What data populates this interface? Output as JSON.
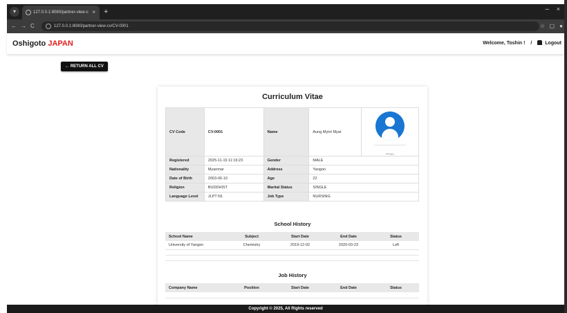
{
  "browser": {
    "tab_title": "127.0.0.1:8080/partner-view-c",
    "tab_close": "×",
    "new_tab": "+",
    "back": "←",
    "forward": "→",
    "reload": "C",
    "url": "127.0.0.1:8080/partner-view-cv/CV-0001",
    "window_minimize": "–",
    "window_close": "×",
    "icons": [
      "globe-icon",
      "star-icon",
      "extensions-icon",
      "profile-icon"
    ]
  },
  "nav": {
    "brand": "Oshigoto",
    "brand_accent": "JAPAN",
    "welcome": "Welcome, Toshin !",
    "separator": "/",
    "logout": "Logout"
  },
  "return_button": "← RETURN ALL CV",
  "cv": {
    "title": "Curriculum Vitae",
    "cv_code_label": "CV Code",
    "cv_code": "CV-0001",
    "name_label": "Name",
    "name": "Aung Myint Myat",
    "photo_caption": "Photo",
    "rows": [
      {
        "l1": "Registered",
        "v1": "2025-11-19 11:16:23",
        "l2": "Gender",
        "v2": "MALE"
      },
      {
        "l1": "Nationality",
        "v1": "Myanmar",
        "l2": "Address",
        "v2": "Yangon"
      },
      {
        "l1": "Date of Birth",
        "v1": "2003-06-10",
        "l2": "Age",
        "v2": "22"
      },
      {
        "l1": "Religion",
        "v1": "BUDDHIST",
        "l2": "Marital Status",
        "v2": "SINGLE"
      },
      {
        "l1": "Language Level",
        "v1": "JLPT N1",
        "l2": "Job Type",
        "v2": "NURSING"
      }
    ]
  },
  "school": {
    "title": "School History",
    "headers": [
      "School Name",
      "Subject",
      "Start Date",
      "End Date",
      "Status"
    ],
    "rows": [
      [
        "University of Yangon",
        "Chemistry",
        "2019-12-02",
        "2020-03-23",
        "Left"
      ]
    ]
  },
  "job": {
    "title": "Job History",
    "headers": [
      "Company Name",
      "Position",
      "Start Date",
      "End Date",
      "Status"
    ]
  },
  "footer": "Copyright © 2025, All Rights reserved",
  "colors": {
    "brand_accent": "#e0201e",
    "avatar": "#1976d2"
  }
}
